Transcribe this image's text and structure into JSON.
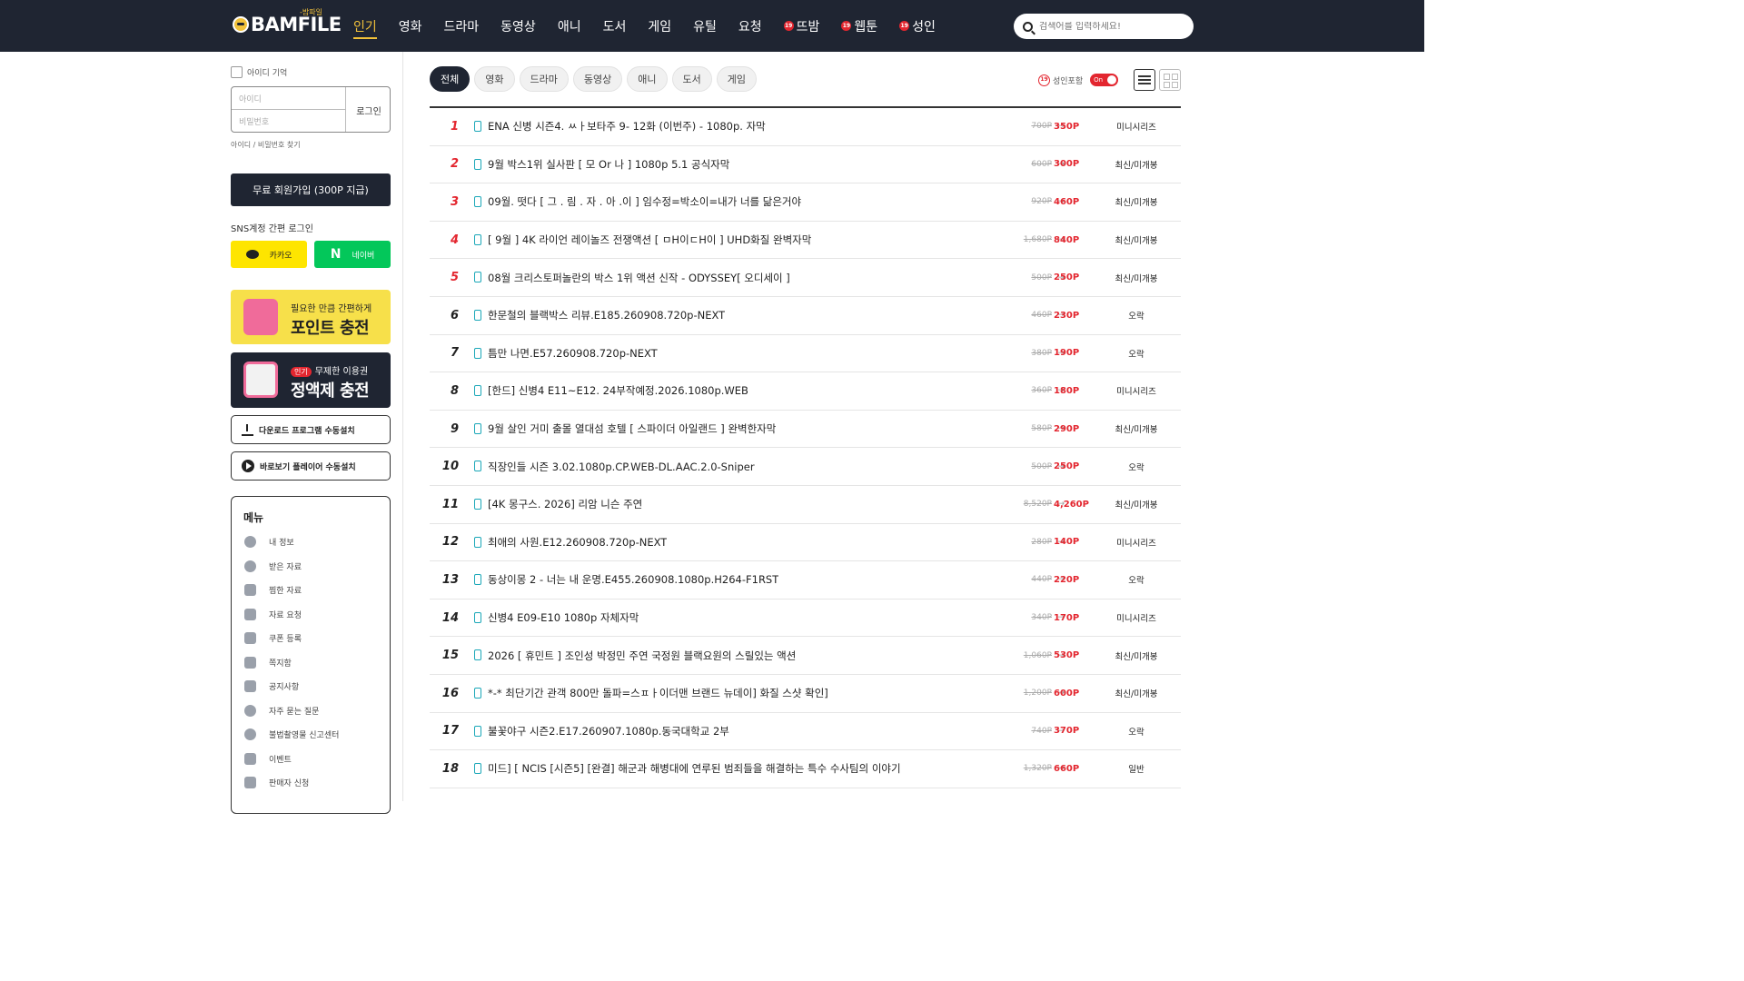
{
  "brand": {
    "name": "BAMFILE",
    "sub": "-밤파일"
  },
  "nav": [
    {
      "label": "인기",
      "active": true,
      "adult": false
    },
    {
      "label": "영화",
      "active": false,
      "adult": false
    },
    {
      "label": "드라마",
      "active": false,
      "adult": false
    },
    {
      "label": "동영상",
      "active": false,
      "adult": false
    },
    {
      "label": "애니",
      "active": false,
      "adult": false
    },
    {
      "label": "도서",
      "active": false,
      "adult": false
    },
    {
      "label": "게임",
      "active": false,
      "adult": false
    },
    {
      "label": "유틸",
      "active": false,
      "adult": false
    },
    {
      "label": "요청",
      "active": false,
      "adult": false
    },
    {
      "label": "뜨밤",
      "active": false,
      "adult": true
    },
    {
      "label": "웹툰",
      "active": false,
      "adult": true
    },
    {
      "label": "성인",
      "active": false,
      "adult": true
    }
  ],
  "badge19": "19",
  "search": {
    "placeholder": "검색어를 입력하세요!"
  },
  "login": {
    "remember": "아이디 기억",
    "id_placeholder": "아이디",
    "pw_placeholder": "비밀번호",
    "login_button": "로그인",
    "find": "아이디 / 비밀번호 찾기",
    "join": "무료 회원가입 (300P 지급)",
    "sns_label": "SNS계정 간편 로그인",
    "kakao": "카카오",
    "naver": "네이버"
  },
  "banners": {
    "point_top": "필요한 만큼 간편하게",
    "point_main": "포인트 충전",
    "plan_hot": "인기",
    "plan_top": "무제한 이용권",
    "plan_main": "정액제 충전"
  },
  "installs": {
    "download": "다운로드 프로그램 수동설치",
    "player": "바로보기 플레이어 수동설치"
  },
  "menu": {
    "title": "메뉴",
    "items": [
      "내 정보",
      "받은 자료",
      "찜한 자료",
      "자료 요청",
      "쿠폰 등록",
      "쪽지함",
      "공지사항",
      "자주 묻는 질문",
      "불법촬영물 신고센터",
      "이벤트",
      "판매자 신청"
    ]
  },
  "tabs": [
    {
      "label": "전체",
      "active": true
    },
    {
      "label": "영화",
      "active": false
    },
    {
      "label": "드라마",
      "active": false
    },
    {
      "label": "동영상",
      "active": false
    },
    {
      "label": "애니",
      "active": false
    },
    {
      "label": "도서",
      "active": false
    },
    {
      "label": "게임",
      "active": false
    }
  ],
  "adult_filter": {
    "label": "성인포함",
    "toggle": "On"
  },
  "colors": {
    "accent": "#f2c23a",
    "dark": "#1f2532",
    "red": "#e3262f",
    "teal": "#1aa7b8"
  },
  "items": [
    {
      "rank": "1",
      "title": "ENA 신병 시즌4. ㅆㅏ보타주 9- 12화 (이번주) - 1080p. 자막",
      "old": "700P",
      "new": "350P",
      "cat": "미니시리즈"
    },
    {
      "rank": "2",
      "title": "9월 박스1위 실사판 [ 모 Or 나 ] 1080p 5.1 공식자막",
      "old": "600P",
      "new": "300P",
      "cat": "최신/미개봉"
    },
    {
      "rank": "3",
      "title": "09월. 떳다 [ 그 . 림 . 자 . 아 .이 ] 임수정=박소이=내가 너를 닮은거야",
      "old": "920P",
      "new": "460P",
      "cat": "최신/미개봉"
    },
    {
      "rank": "4",
      "title": "[ 9월 ] 4K 라이언 레이놀즈 전쟁액션 [ ㅁH이ㄷH이 ] UHD화질 완벽자막",
      "old": "1,680P",
      "new": "840P",
      "cat": "최신/미개봉"
    },
    {
      "rank": "5",
      "title": "08월 크리스토퍼놀란의 박스 1위 액션 신작 - ODYSSEY[ 오디세이 ]",
      "old": "500P",
      "new": "250P",
      "cat": "최신/미개봉"
    },
    {
      "rank": "6",
      "title": "한문철의 블랙박스 리뷰.E185.260908.720p-NEXT",
      "old": "460P",
      "new": "230P",
      "cat": "오락"
    },
    {
      "rank": "7",
      "title": "틈만 나면.E57.260908.720p-NEXT",
      "old": "380P",
      "new": "190P",
      "cat": "오락"
    },
    {
      "rank": "8",
      "title": "[한드] 신병4 E11~E12. 24부작예정.2026.1080p.WEB",
      "old": "360P",
      "new": "180P",
      "cat": "미니시리즈"
    },
    {
      "rank": "9",
      "title": "9월 살인 거미 출몰 열대섬 호텔 [ 스파이더 아일랜드 ] 완벽한자막",
      "old": "580P",
      "new": "290P",
      "cat": "최신/미개봉"
    },
    {
      "rank": "10",
      "title": "직장인들 시즌 3.02.1080p.CP.WEB-DL.AAC.2.0-Sniper",
      "old": "500P",
      "new": "250P",
      "cat": "오락"
    },
    {
      "rank": "11",
      "title": "[4K 몽구스. 2026] 리암 니슨 주연",
      "old": "8,520P",
      "new": "4,260P",
      "cat": "최신/미개봉"
    },
    {
      "rank": "12",
      "title": "최애의 사원.E12.260908.720p-NEXT",
      "old": "280P",
      "new": "140P",
      "cat": "미니시리즈"
    },
    {
      "rank": "13",
      "title": "동상이몽 2 - 너는 내 운명.E455.260908.1080p.H264-F1RST",
      "old": "440P",
      "new": "220P",
      "cat": "오락"
    },
    {
      "rank": "14",
      "title": "신병4 E09-E10 1080p 자체자막",
      "old": "340P",
      "new": "170P",
      "cat": "미니시리즈"
    },
    {
      "rank": "15",
      "title": "2026 [ 휴민트 ] 조인성 박정민 주연 국정원 블랙요원의 스릴있는 액션",
      "old": "1,060P",
      "new": "530P",
      "cat": "최신/미개봉"
    },
    {
      "rank": "16",
      "title": "*-* 최단기간 관객 800만 돌파=스ㅍㅏ이더맨 브랜드 뉴데이] 화질 스샷 확인]",
      "old": "1,200P",
      "new": "600P",
      "cat": "최신/미개봉"
    },
    {
      "rank": "17",
      "title": "불꽃야구 시즌2.E17.260907.1080p.동국대학교 2부",
      "old": "740P",
      "new": "370P",
      "cat": "오락"
    },
    {
      "rank": "18",
      "title": "미드] [ NCIS [시즌5] [완결] 해군과 해병대에 연루된 범죄들을 해결하는 특수 수사팀의 이야기",
      "old": "1,320P",
      "new": "660P",
      "cat": "일반"
    }
  ]
}
